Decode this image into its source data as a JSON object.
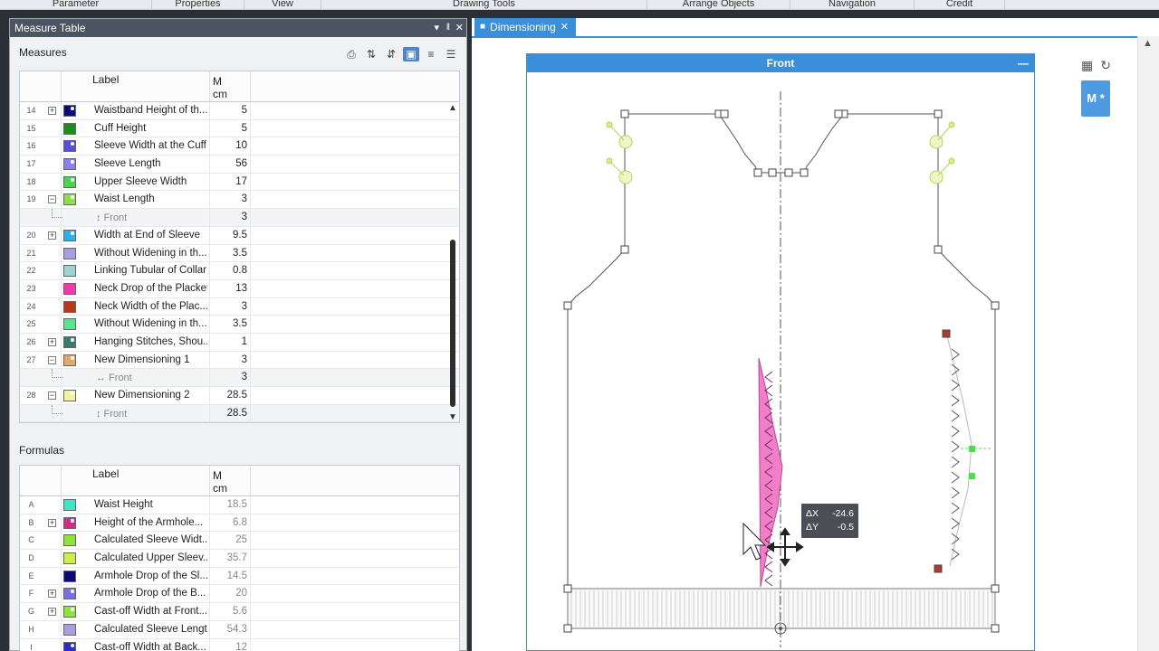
{
  "ribbon": [
    "Parameter",
    "Properties",
    "View",
    "Drawing Tools",
    "Arrange Objects",
    "Navigation",
    "Credit"
  ],
  "panel": {
    "title": "Measure Table",
    "pin": "▓",
    "pin_icon": "pin-icon",
    "close": "✕",
    "menu": "▾"
  },
  "measures": {
    "section_label": "Measures",
    "header_label": "Label",
    "header_m": "M",
    "header_unit": "cm",
    "toolbar_icons": [
      "printer-icon",
      "sort-icon",
      "sort-numeric-icon",
      "bookmark-icon",
      "lines-icon",
      "lines-alt-icon"
    ],
    "rows": [
      {
        "num": "14",
        "exp": "+",
        "color": "#0a0a7a",
        "dot": true,
        "label": "Waistband Height of th...",
        "value": "5"
      },
      {
        "num": "15",
        "exp": "",
        "color": "#1a8f1a",
        "dot": false,
        "label": "Cuff Height",
        "value": "5"
      },
      {
        "num": "16",
        "exp": "",
        "color": "#5a4be0",
        "dot": true,
        "label": "Sleeve Width at the Cuff",
        "value": "10"
      },
      {
        "num": "17",
        "exp": "",
        "color": "#8a7ff0",
        "dot": true,
        "label": "Sleeve Length",
        "value": "56"
      },
      {
        "num": "18",
        "exp": "",
        "color": "#49d64a",
        "dot": true,
        "label": "Upper Sleeve Width",
        "value": "17"
      },
      {
        "num": "19",
        "exp": "−",
        "color": "#8ee04a",
        "dot": true,
        "label": "Waist Length",
        "value": "3"
      },
      {
        "num": "",
        "exp": "",
        "sub": true,
        "label": "↕  Front",
        "value": "3"
      },
      {
        "num": "20",
        "exp": "+",
        "color": "#2db2e8",
        "dot": true,
        "label": "Width at End of Sleeve",
        "value": "9.5"
      },
      {
        "num": "21",
        "exp": "",
        "color": "#a99ee0",
        "dot": false,
        "label": "Without Widening in th...",
        "value": "3.5"
      },
      {
        "num": "22",
        "exp": "",
        "color": "#9fd3cf",
        "dot": false,
        "label": "Linking Tubular of Collar",
        "value": "0.8"
      },
      {
        "num": "23",
        "exp": "",
        "color": "#ec3ab0",
        "dot": false,
        "label": "Neck Drop of the Placket",
        "value": "13"
      },
      {
        "num": "24",
        "exp": "",
        "color": "#b83a14",
        "dot": false,
        "label": "Neck Width of the Plac...",
        "value": "3"
      },
      {
        "num": "25",
        "exp": "",
        "color": "#55e68e",
        "dot": false,
        "label": "Without Widening in th...",
        "value": "3.5"
      },
      {
        "num": "26",
        "exp": "+",
        "color": "#3a7a70",
        "dot": true,
        "label": "Hanging Stitches, Shou...",
        "value": "1"
      },
      {
        "num": "27",
        "exp": "−",
        "color": "#e0a86a",
        "dot": true,
        "label": "New Dimensioning 1",
        "value": "3"
      },
      {
        "num": "",
        "exp": "",
        "sub": true,
        "label": "↔  Front",
        "value": "3"
      },
      {
        "num": "28",
        "exp": "−",
        "color": "#f2f2a0",
        "dot": true,
        "label": "New Dimensioning 2",
        "value": "28.5"
      },
      {
        "num": "",
        "exp": "",
        "sub": true,
        "label": "↕  Front",
        "value": "28.5"
      }
    ]
  },
  "formulas": {
    "section_label": "Formulas",
    "header_label": "Label",
    "header_m": "M",
    "header_unit": "cm",
    "rows": [
      {
        "num": "A",
        "exp": "",
        "color": "#3ae8c8",
        "dot": false,
        "label": "Waist Height",
        "value": "18.5"
      },
      {
        "num": "B",
        "exp": "+",
        "color": "#d62a8a",
        "dot": true,
        "label": "Height of the Armhole...",
        "value": "6.8"
      },
      {
        "num": "C",
        "exp": "",
        "color": "#8ee43a",
        "dot": false,
        "label": "Calculated Sleeve Widt...",
        "value": "25"
      },
      {
        "num": "D",
        "exp": "",
        "color": "#c9f04a",
        "dot": false,
        "label": "Calculated Upper Sleev...",
        "value": "35.7"
      },
      {
        "num": "E",
        "exp": "",
        "color": "#0a0a7a",
        "dot": false,
        "label": "Armhole Drop of the Sl...",
        "value": "14.5"
      },
      {
        "num": "F",
        "exp": "+",
        "color": "#7a6ee0",
        "dot": true,
        "label": "Armhole Drop of the B...",
        "value": "20"
      },
      {
        "num": "G",
        "exp": "+",
        "color": "#8ee43a",
        "dot": true,
        "label": "Cast-off Width at Front...",
        "value": "5.6"
      },
      {
        "num": "H",
        "exp": "",
        "color": "#a99ee0",
        "dot": false,
        "label": "Calculated Sleeve Length",
        "value": "54.3"
      },
      {
        "num": "I",
        "exp": "",
        "color": "#2a2ad0",
        "dot": true,
        "label": "Cast-off Width at Back...",
        "value": "12"
      }
    ]
  },
  "document": {
    "tab_label": "Dimensioning",
    "tab_close": "✕",
    "front_title": "Front",
    "front_min": "—",
    "mstar_label": "M *",
    "tooltip": {
      "dx_label": "ΔX",
      "dx_value": "-24.6",
      "dy_label": "ΔY",
      "dy_value": "-0.5"
    }
  }
}
